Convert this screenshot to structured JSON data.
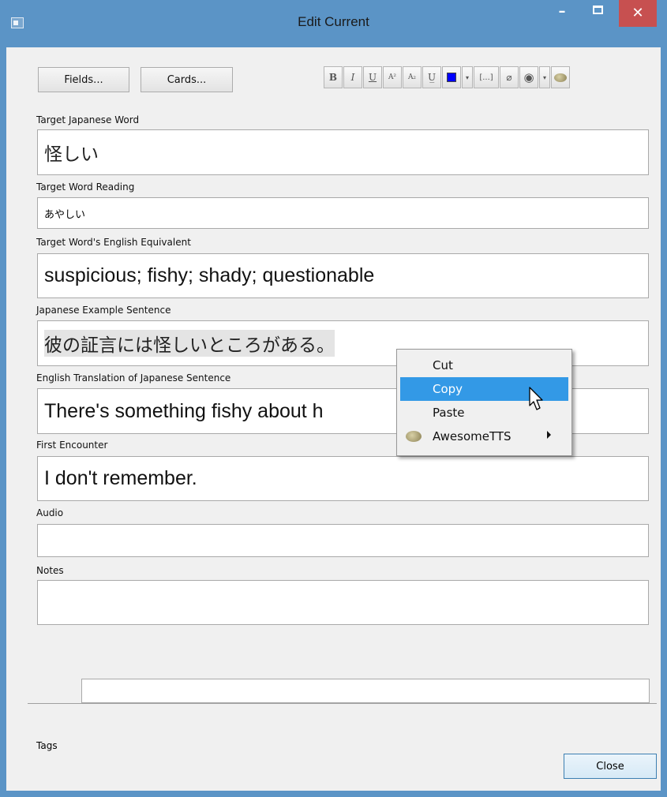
{
  "window": {
    "title": "Edit Current",
    "min_symbol": "–",
    "close_symbol": "✕"
  },
  "top_buttons": {
    "fields": "Fields...",
    "cards": "Cards..."
  },
  "toolbar": {
    "bold": "B",
    "italic": "I",
    "underline": "U",
    "superscript": "A²",
    "subscript": "A₂",
    "clear_format": "U̲",
    "color_dropdown": "▾",
    "cloze": "[...]",
    "attach": "⌀",
    "record": "◉",
    "record_dropdown": "▾",
    "text_color": "#0000ff"
  },
  "fields": [
    {
      "label": "Target Japanese Word",
      "value": "怪しい"
    },
    {
      "label": "Target Word Reading",
      "value": "あやしい"
    },
    {
      "label": "Target Word's English Equivalent",
      "value": "suspicious; fishy; shady; questionable"
    },
    {
      "label": "Japanese Example Sentence",
      "value": "彼の証言には怪しいところがある。"
    },
    {
      "label": "English Translation of Japanese Sentence",
      "value": "There's something fishy about h"
    },
    {
      "label": "First Encounter",
      "value": "I don't remember."
    },
    {
      "label": "Audio",
      "value": ""
    },
    {
      "label": "Notes",
      "value": ""
    }
  ],
  "tags": {
    "label": "Tags",
    "value": ""
  },
  "close_button": "Close",
  "context_menu": {
    "items": [
      {
        "label": "Cut"
      },
      {
        "label": "Copy"
      },
      {
        "label": "Paste"
      },
      {
        "label": "AwesomeTTS"
      }
    ]
  }
}
